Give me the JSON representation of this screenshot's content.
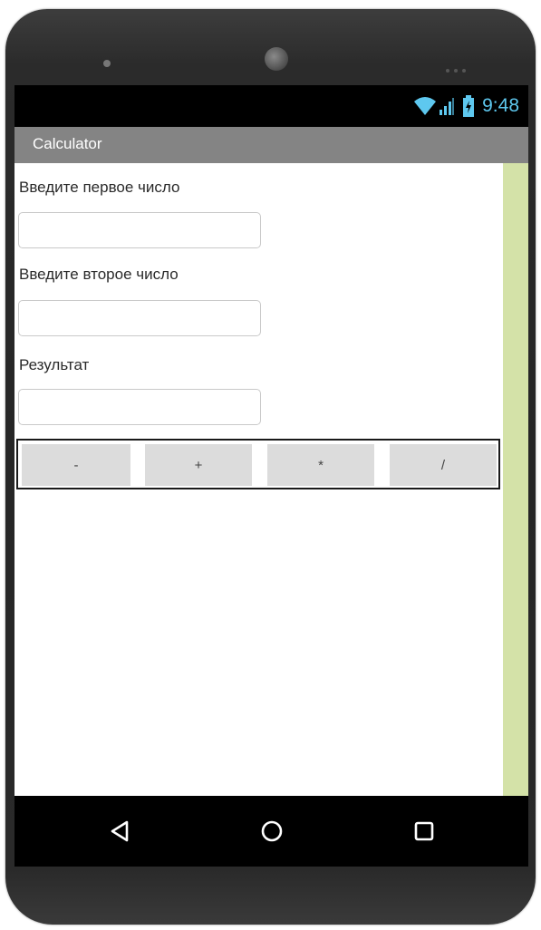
{
  "status_bar": {
    "time": "9:48",
    "icons": [
      "wifi-icon",
      "signal-icon",
      "battery-icon"
    ],
    "accent_color": "#5ec8ef"
  },
  "app": {
    "title": "Calculator"
  },
  "form": {
    "first_label": "Введите первое число",
    "first_value": "",
    "second_label": "Введите второе число",
    "second_value": "",
    "result_label": "Результат",
    "result_value": ""
  },
  "operations": {
    "minus": "-",
    "plus": "+",
    "multiply": "*",
    "divide": "/"
  },
  "nav": {
    "icons": [
      "back-icon",
      "home-icon",
      "recents-icon"
    ]
  },
  "colors": {
    "title_bar": "#848484",
    "side_strip": "#d4e2a8",
    "button": "#dcdcdc"
  }
}
